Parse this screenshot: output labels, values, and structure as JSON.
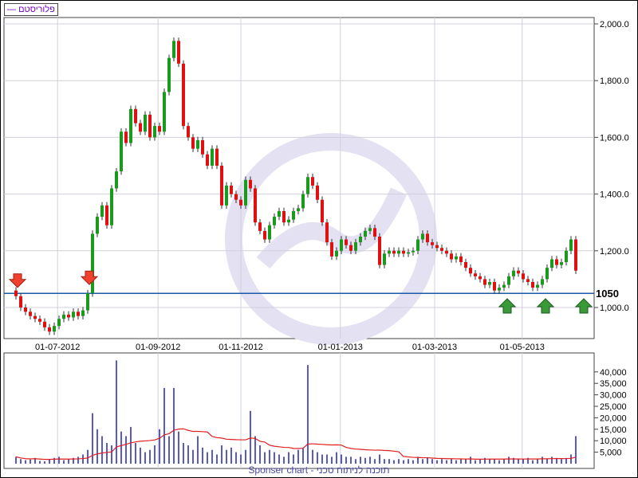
{
  "legend": {
    "label": "פלוריסטם",
    "color": "#7000c0"
  },
  "footer": "Sponser chart - תוכנה לניתוח טכני",
  "chart_data": {
    "type": "candlestick",
    "x_tick_labels": [
      {
        "label": "01-07-2012",
        "index": 8.7
      },
      {
        "label": "01-09-2012",
        "index": 29.7
      },
      {
        "label": "01-11-2012",
        "index": 47
      },
      {
        "label": "01-01-2013",
        "index": 67.8
      },
      {
        "label": "01-03-2013",
        "index": 87.5
      },
      {
        "label": "01-05-2013",
        "index": 105.8
      }
    ],
    "y_ticks": [
      {
        "v": 1000,
        "label": "1,000.0"
      },
      {
        "v": 1200,
        "label": "1,200.0"
      },
      {
        "v": 1400,
        "label": "1,400.0"
      },
      {
        "v": 1600,
        "label": "1,600.0"
      },
      {
        "v": 1800,
        "label": "1,800.0"
      },
      {
        "v": 2000,
        "label": "2,000.0"
      }
    ],
    "ylim": [
      890,
      2022
    ],
    "level_line": {
      "value": 1050,
      "label": "1050",
      "color": "#1a5aa8"
    },
    "close": [
      1040,
      1000,
      985,
      970,
      960,
      950,
      930,
      915,
      935,
      960,
      975,
      965,
      985,
      970,
      990,
      1050,
      1260,
      1320,
      1360,
      1290,
      1420,
      1480,
      1620,
      1580,
      1700,
      1650,
      1620,
      1680,
      1600,
      1640,
      1620,
      1760,
      1880,
      1940,
      1860,
      1640,
      1600,
      1560,
      1590,
      1540,
      1500,
      1560,
      1500,
      1360,
      1430,
      1400,
      1380,
      1360,
      1450,
      1420,
      1300,
      1270,
      1240,
      1290,
      1320,
      1340,
      1300,
      1310,
      1340,
      1350,
      1400,
      1460,
      1430,
      1380,
      1300,
      1230,
      1180,
      1200,
      1240,
      1220,
      1200,
      1230,
      1250,
      1270,
      1280,
      1250,
      1150,
      1190,
      1200,
      1190,
      1200,
      1190,
      1195,
      1200,
      1240,
      1260,
      1230,
      1220,
      1210,
      1200,
      1190,
      1170,
      1180,
      1160,
      1140,
      1120,
      1110,
      1100,
      1080,
      1090,
      1060,
      1070,
      1080,
      1110,
      1130,
      1120,
      1100,
      1090,
      1070,
      1080,
      1100,
      1140,
      1170,
      1150,
      1160,
      1200,
      1240,
      1130
    ],
    "sell_signals": [
      0,
      15
    ],
    "buy_signals": [
      101,
      109,
      117
    ],
    "volume": {
      "y_ticks": [
        {
          "v": 5000,
          "label": "5,000"
        },
        {
          "v": 10000,
          "label": "10,000"
        },
        {
          "v": 15000,
          "label": "15,000"
        },
        {
          "v": 20000,
          "label": "20,000"
        },
        {
          "v": 25000,
          "label": "25,000"
        },
        {
          "v": 30000,
          "label": "30,000"
        },
        {
          "v": 35000,
          "label": "35,000"
        },
        {
          "v": 40000,
          "label": "40,000"
        }
      ],
      "ylim": [
        0,
        48000
      ],
      "values": [
        3000,
        2000,
        1500,
        1800,
        2500,
        1200,
        1000,
        2000,
        2500,
        3000,
        1500,
        2000,
        2500,
        3000,
        4000,
        6000,
        22000,
        15000,
        12000,
        9000,
        8000,
        45000,
        14000,
        12000,
        16000,
        9000,
        7000,
        5000,
        6000,
        8000,
        15000,
        33000,
        12000,
        33000,
        14000,
        9000,
        8000,
        6000,
        12000,
        7000,
        5000,
        6000,
        4000,
        8000,
        6000,
        7000,
        5000,
        4000,
        6000,
        23000,
        12000,
        8000,
        5000,
        6000,
        5000,
        4000,
        3000,
        5000,
        4000,
        6000,
        7000,
        43000,
        6000,
        5000,
        4000,
        4000,
        3000,
        5000,
        4000,
        3000,
        3000,
        2000,
        3000,
        2500,
        3000,
        2000,
        4000,
        2000,
        2000,
        1500,
        2000,
        1500,
        2000,
        1500,
        3000,
        2000,
        2500,
        2000,
        1500,
        2000,
        1500,
        2000,
        1500,
        2000,
        2000,
        3000,
        1500,
        2000,
        2500,
        2000,
        2000,
        1500,
        2000,
        3000,
        2500,
        2000,
        2000,
        2500,
        1500,
        2000,
        3000,
        2000,
        3000,
        2500,
        2000,
        2500,
        4000,
        12000
      ]
    }
  }
}
